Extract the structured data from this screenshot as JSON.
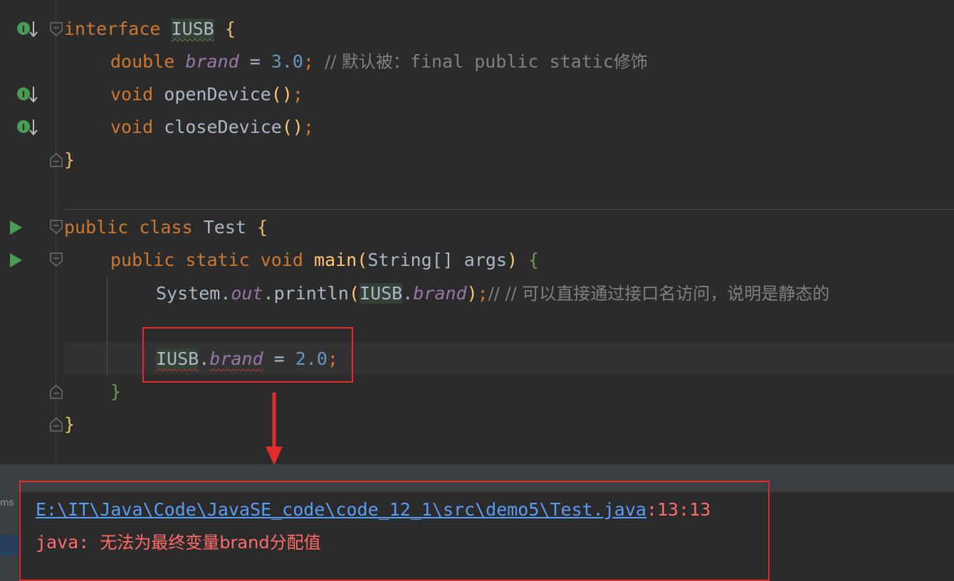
{
  "colors": {
    "background": "#2b2b2b",
    "keyword": "#cc7832",
    "field": "#9876aa",
    "number": "#6897bb",
    "comment": "#808080",
    "error": "#ff6b68",
    "link": "#589df6",
    "annotation_box": "#e02c2c"
  },
  "code": {
    "interface_decl": {
      "kw": "interface",
      "name": "IUSB",
      "brace": "{"
    },
    "field_decl": {
      "type": "double",
      "name": "brand",
      "op": "=",
      "value": "3.0",
      "semi": ";",
      "comment_prefix": "// 默认被：",
      "comment_ascii": "final public static",
      "comment_suffix": "修饰"
    },
    "method1": {
      "type": "void",
      "name": "openDevice",
      "parens": "()",
      "semi": ";"
    },
    "method2": {
      "type": "void",
      "name": "closeDevice",
      "parens": "()",
      "semi": ";"
    },
    "interface_close": "}",
    "class_decl": {
      "kw1": "public",
      "kw2": "class",
      "name": "Test",
      "brace": "{"
    },
    "main_decl": {
      "kw1": "public",
      "kw2": "static",
      "kw3": "void",
      "name": "main",
      "open": "(",
      "param_type": "String[]",
      "param_name": "args",
      "close": ")",
      "brace": "{"
    },
    "println_line": {
      "obj": "System",
      "dot1": ".",
      "field": "out",
      "dot2": ".",
      "method": "println",
      "open": "(",
      "arg_type": "IUSB",
      "dot3": ".",
      "arg_field": "brand",
      "close": ")",
      "semi": ";",
      "comment": "// // 可以直接通过接口名访问，说明是静态的"
    },
    "assign_line": {
      "obj": "IUSB",
      "dot": ".",
      "field": "brand",
      "op": "=",
      "value": "2.0",
      "semi": ";"
    },
    "main_close": "}",
    "class_close": "}"
  },
  "gutter": {
    "implement_icon": "interface-implemented-icon",
    "run_icon": "run-triangle-icon",
    "fold_icon": "fold-marker-icon",
    "implement_letter": "I"
  },
  "tool_window": {
    "side_label": "ms"
  },
  "output": {
    "path": "E:\\IT\\Java\\Code\\JavaSE_code\\code_12_1\\src\\demo5\\Test.java",
    "position": ":13:13",
    "error_prefix": "java: ",
    "error_message": "无法为最终变量brand分配值"
  }
}
